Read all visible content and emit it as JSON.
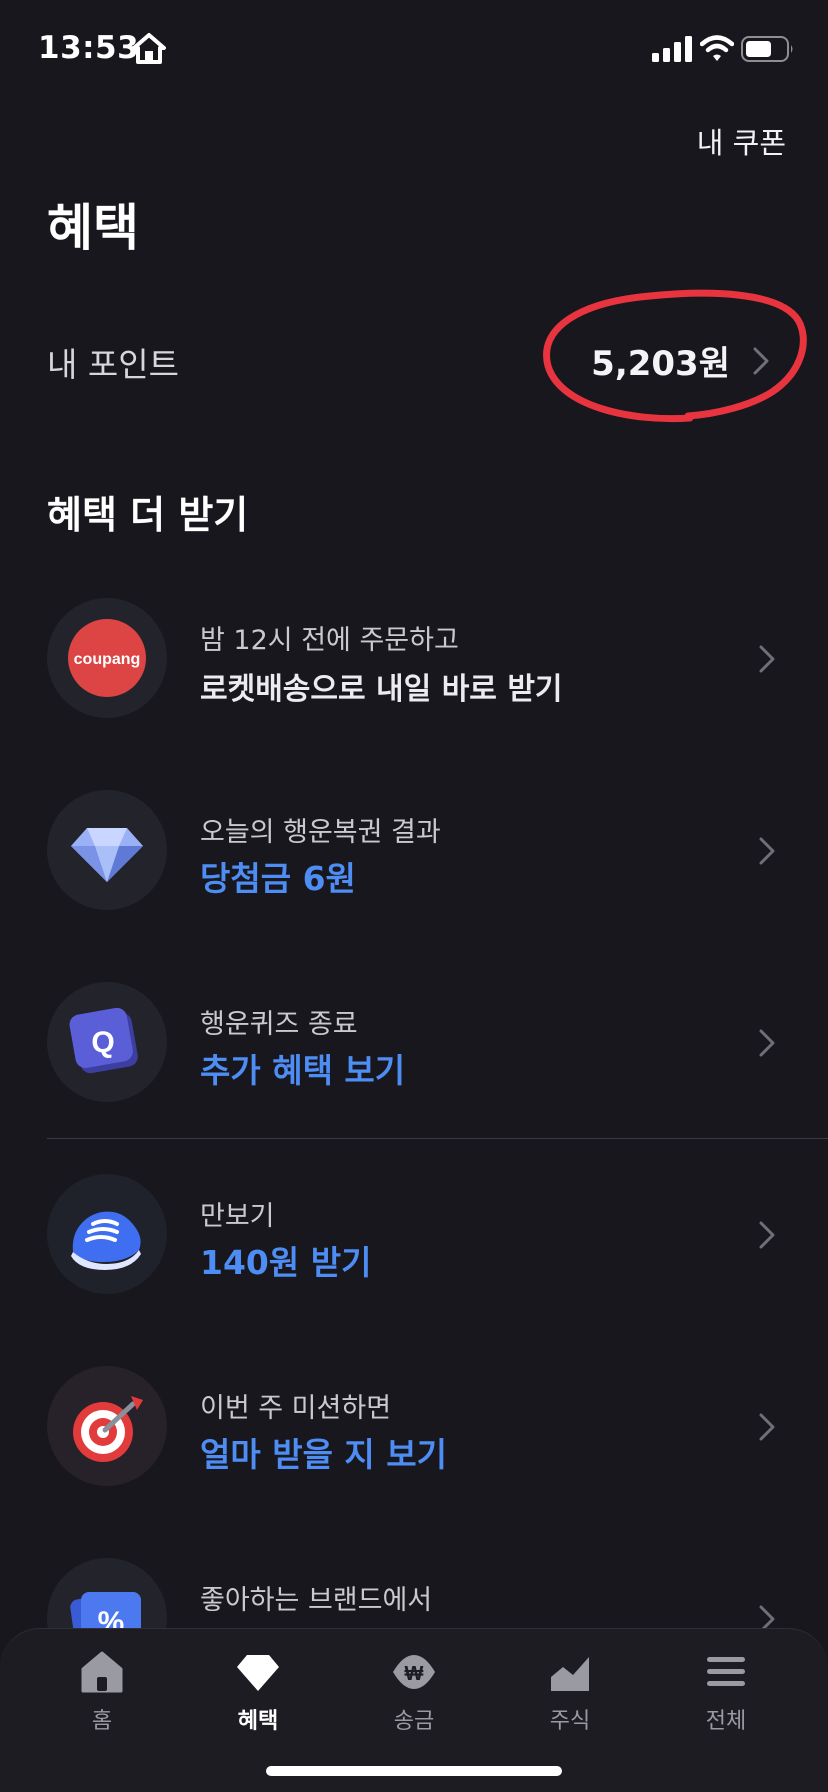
{
  "status_bar": {
    "time": "13:53",
    "icons": [
      "home-icon",
      "signal-icon",
      "wifi-icon",
      "battery-icon"
    ]
  },
  "header": {
    "coupon_link": "내 쿠폰",
    "title": "혜택"
  },
  "points": {
    "label": "내 포인트",
    "value": "5,203원"
  },
  "section": {
    "title": "혜택 더 받기"
  },
  "benefits": [
    {
      "icon": "coupang-icon",
      "logo_text": "coupang",
      "subtitle": "밤 12시 전에 주문하고",
      "title": "로켓배송으로 내일 바로 받기",
      "style": "white"
    },
    {
      "icon": "diamond-icon",
      "subtitle": "오늘의 행운복권 결과",
      "title": "당첨금 6원",
      "style": "blue"
    },
    {
      "icon": "quiz-q-icon",
      "subtitle": "행운퀴즈 종료",
      "title": "추가 혜택 보기",
      "style": "blue"
    },
    {
      "icon": "sneaker-icon",
      "subtitle": "만보기",
      "title": "140원 받기",
      "style": "blue"
    },
    {
      "icon": "target-icon",
      "subtitle": "이번 주 미션하면",
      "title": "얼마 받을 지 보기",
      "style": "blue"
    },
    {
      "icon": "percent-coupon-icon",
      "subtitle": "좋아하는 브랜드에서",
      "title": "",
      "style": "blue"
    }
  ],
  "bottom_nav": [
    {
      "label": "홈",
      "icon": "home-icon",
      "active": false
    },
    {
      "label": "혜택",
      "icon": "diamond-icon",
      "active": true
    },
    {
      "label": "송금",
      "icon": "won-transfer-icon",
      "active": false
    },
    {
      "label": "주식",
      "icon": "stock-chart-icon",
      "active": false
    },
    {
      "label": "전체",
      "icon": "menu-icon",
      "active": false
    }
  ],
  "colors": {
    "background": "#18171d",
    "accent_blue": "#4d8df4",
    "annotation_red": "#e8343f"
  }
}
